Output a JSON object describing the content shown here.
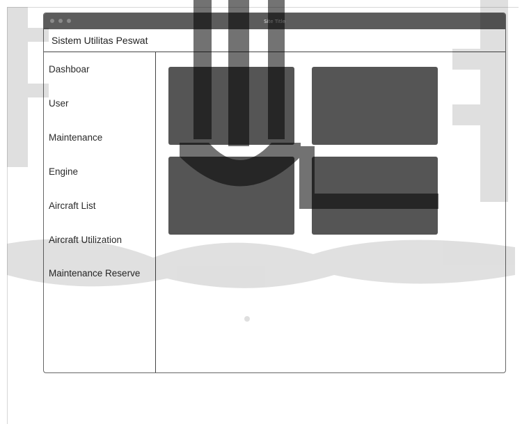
{
  "window": {
    "title": "Site Title",
    "controls": [
      "close",
      "minimize",
      "maximize"
    ]
  },
  "app": {
    "title": "Sistem Utilitas Peswat"
  },
  "sidebar": {
    "items": [
      {
        "label": "Dashboar"
      },
      {
        "label": "User"
      },
      {
        "label": "Maintenance"
      },
      {
        "label": "Engine"
      },
      {
        "label": "Aircraft List"
      },
      {
        "label": "Aircraft Utilization"
      },
      {
        "label": "Maintenance Reserve"
      }
    ]
  },
  "content": {
    "card_color": "#555555"
  }
}
